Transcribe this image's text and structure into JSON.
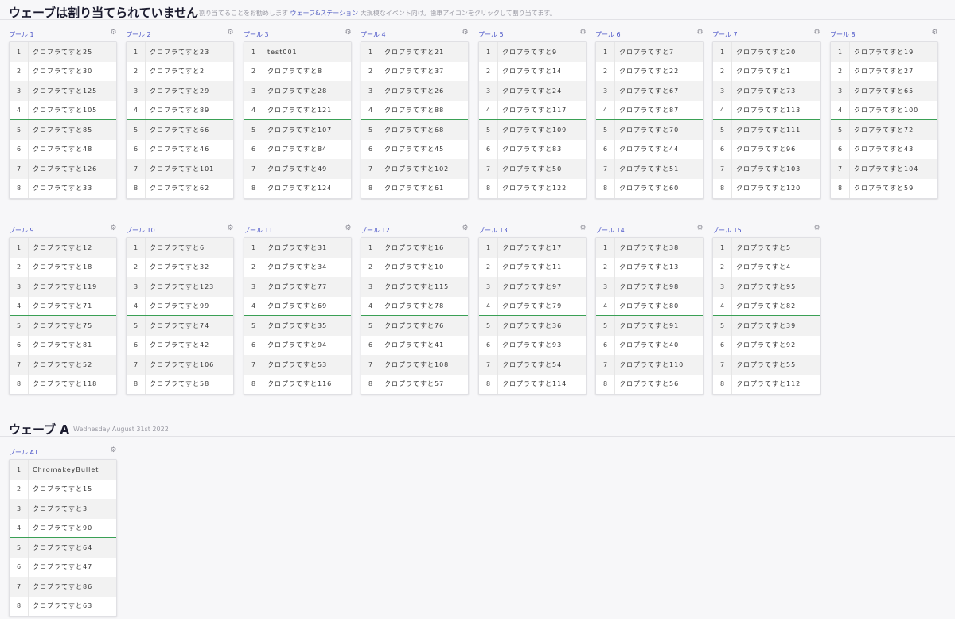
{
  "unassigned": {
    "title": "ウェーブは割り当てられていません",
    "subtitle_pre": "割り当てることをお勧めします",
    "subtitle_link": "ウェーブ&ステーション",
    "subtitle_post": "大規模なイベント向け。歯車アイコンをクリックして割り当てます。"
  },
  "wave_a": {
    "title": "ウェーブ A",
    "date": "Wednesday August 31st 2022"
  },
  "gear_icon": "gear-icon",
  "pools": [
    {
      "name": "プール 1",
      "players": [
        "クロプラてすと25",
        "クロプラてすと30",
        "クロプラてすと125",
        "クロプラてすと105",
        "クロプラてすと85",
        "クロプラてすと48",
        "クロプラてすと126",
        "クロプラてすと33"
      ]
    },
    {
      "name": "プール 2",
      "players": [
        "クロプラてすと23",
        "クロプラてすと2",
        "クロプラてすと29",
        "クロプラてすと89",
        "クロプラてすと66",
        "クロプラてすと46",
        "クロプラてすと101",
        "クロプラてすと62"
      ]
    },
    {
      "name": "プール 3",
      "players": [
        "test001",
        "クロプラてすと8",
        "クロプラてすと28",
        "クロプラてすと121",
        "クロプラてすと107",
        "クロプラてすと84",
        "クロプラてすと49",
        "クロプラてすと124"
      ]
    },
    {
      "name": "プール 4",
      "players": [
        "クロプラてすと21",
        "クロプラてすと37",
        "クロプラてすと26",
        "クロプラてすと88",
        "クロプラてすと68",
        "クロプラてすと45",
        "クロプラてすと102",
        "クロプラてすと61"
      ]
    },
    {
      "name": "プール 5",
      "players": [
        "クロプラてすと9",
        "クロプラてすと14",
        "クロプラてすと24",
        "クロプラてすと117",
        "クロプラてすと109",
        "クロプラてすと83",
        "クロプラてすと50",
        "クロプラてすと122"
      ]
    },
    {
      "name": "プール 6",
      "players": [
        "クロプラてすと7",
        "クロプラてすと22",
        "クロプラてすと67",
        "クロプラてすと87",
        "クロプラてすと70",
        "クロプラてすと44",
        "クロプラてすと51",
        "クロプラてすと60"
      ]
    },
    {
      "name": "プール 7",
      "players": [
        "クロプラてすと20",
        "クロプラてすと1",
        "クロプラてすと73",
        "クロプラてすと113",
        "クロプラてすと111",
        "クロプラてすと96",
        "クロプラてすと103",
        "クロプラてすと120"
      ]
    },
    {
      "name": "プール 8",
      "players": [
        "クロプラてすと19",
        "クロプラてすと27",
        "クロプラてすと65",
        "クロプラてすと100",
        "クロプラてすと72",
        "クロプラてすと43",
        "クロプラてすと104",
        "クロプラてすと59"
      ]
    },
    {
      "name": "プール 9",
      "players": [
        "クロプラてすと12",
        "クロプラてすと18",
        "クロプラてすと119",
        "クロプラてすと71",
        "クロプラてすと75",
        "クロプラてすと81",
        "クロプラてすと52",
        "クロプラてすと118"
      ]
    },
    {
      "name": "プール 10",
      "players": [
        "クロプラてすと6",
        "クロプラてすと32",
        "クロプラてすと123",
        "クロプラてすと99",
        "クロプラてすと74",
        "クロプラてすと42",
        "クロプラてすと106",
        "クロプラてすと58"
      ]
    },
    {
      "name": "プール 11",
      "players": [
        "クロプラてすと31",
        "クロプラてすと34",
        "クロプラてすと77",
        "クロプラてすと69",
        "クロプラてすと35",
        "クロプラてすと94",
        "クロプラてすと53",
        "クロプラてすと116"
      ]
    },
    {
      "name": "プール 12",
      "players": [
        "クロプラてすと16",
        "クロプラてすと10",
        "クロプラてすと115",
        "クロプラてすと78",
        "クロプラてすと76",
        "クロプラてすと41",
        "クロプラてすと108",
        "クロプラてすと57"
      ]
    },
    {
      "name": "プール 13",
      "players": [
        "クロプラてすと17",
        "クロプラてすと11",
        "クロプラてすと97",
        "クロプラてすと79",
        "クロプラてすと36",
        "クロプラてすと93",
        "クロプラてすと54",
        "クロプラてすと114"
      ]
    },
    {
      "name": "プール 14",
      "players": [
        "クロプラてすと38",
        "クロプラてすと13",
        "クロプラてすと98",
        "クロプラてすと80",
        "クロプラてすと91",
        "クロプラてすと40",
        "クロプラてすと110",
        "クロプラてすと56"
      ]
    },
    {
      "name": "プール 15",
      "players": [
        "クロプラてすと5",
        "クロプラてすと4",
        "クロプラてすと95",
        "クロプラてすと82",
        "クロプラてすと39",
        "クロプラてすと92",
        "クロプラてすと55",
        "クロプラてすと112"
      ]
    },
    {
      "name": "プール A1",
      "players": [
        "ChromakeyBullet",
        "クロプラてすと15",
        "クロプラてすと3",
        "クロプラてすと90",
        "クロプラてすと64",
        "クロプラてすと47",
        "クロプラてすと86",
        "クロプラてすと63"
      ]
    }
  ]
}
